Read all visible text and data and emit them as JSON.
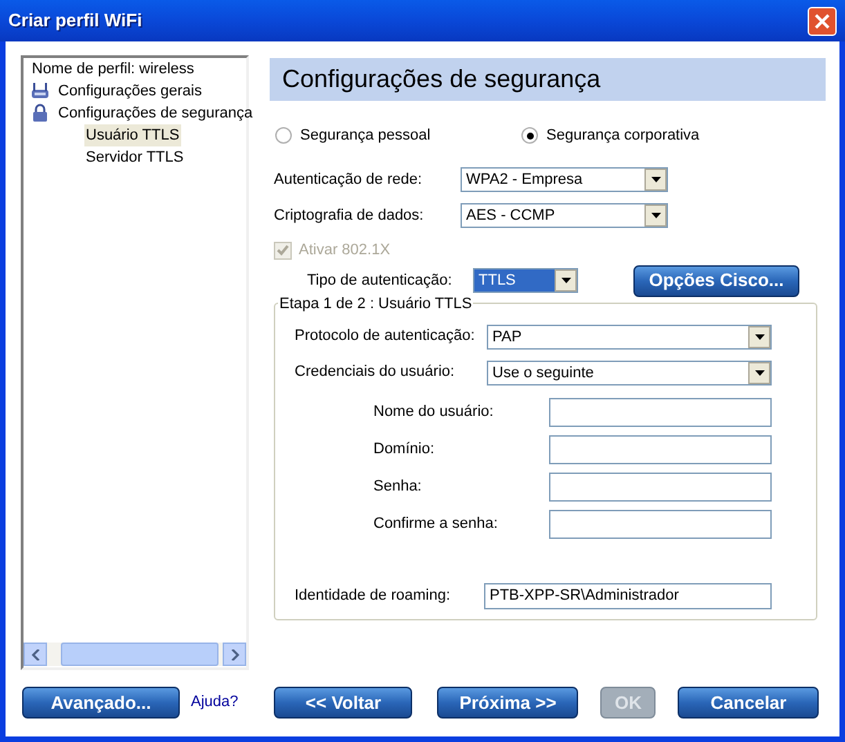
{
  "window": {
    "title": "Criar perfil WiFi"
  },
  "tree": {
    "items": [
      {
        "kind": "text",
        "label": "Nome de perfil: wireless",
        "selected": false
      },
      {
        "kind": "router",
        "label": "Configurações gerais",
        "selected": false
      },
      {
        "kind": "lock",
        "label": "Configurações de segurança",
        "selected": false,
        "children": [
          {
            "label": "Usuário TTLS",
            "selected": true
          },
          {
            "label": "Servidor TTLS",
            "selected": false
          }
        ]
      }
    ]
  },
  "header": "Configurações de segurança",
  "security_mode": [
    {
      "label": "Segurança pessoal",
      "selected": false
    },
    {
      "label": "Segurança corporativa",
      "selected": true
    }
  ],
  "network_auth": {
    "label": "Autenticação de rede:",
    "value": "WPA2 - Empresa"
  },
  "data_encryption": {
    "label": "Criptografia de dados:",
    "value": "AES - CCMP"
  },
  "enable_8021x": {
    "label": "Ativar 802.1X",
    "checked": true,
    "disabled": true
  },
  "auth_type": {
    "label": "Tipo de autenticação:",
    "value": "TTLS"
  },
  "cisco_button": {
    "label": "Opções Cisco..."
  },
  "group": {
    "title": "Etapa 1 de 2 : Usuário TTLS",
    "protocol": {
      "label": "Protocolo de autenticação:",
      "value": "PAP"
    },
    "credentials": {
      "label": "Credenciais do usuário:",
      "value": "Use o seguinte"
    },
    "fields": [
      {
        "label": "Nome do usuário:"
      },
      {
        "label": "Domínio:"
      },
      {
        "label": "Senha:"
      },
      {
        "label": "Confirme a senha:"
      }
    ],
    "roaming": {
      "label": "Identidade de roaming:",
      "value": "PTB-XPP-SR\\Administrador"
    }
  },
  "buttons": [
    {
      "kind": "button",
      "label": "Avançado...",
      "disabled": false
    },
    {
      "kind": "link",
      "label": "Ajuda?"
    },
    {
      "kind": "button",
      "label": "<< Voltar",
      "disabled": false
    },
    {
      "kind": "button",
      "label": "Próxima >>",
      "disabled": false
    },
    {
      "kind": "button",
      "label": "OK",
      "disabled": true
    },
    {
      "kind": "button",
      "label": "Cancelar",
      "disabled": false
    }
  ]
}
